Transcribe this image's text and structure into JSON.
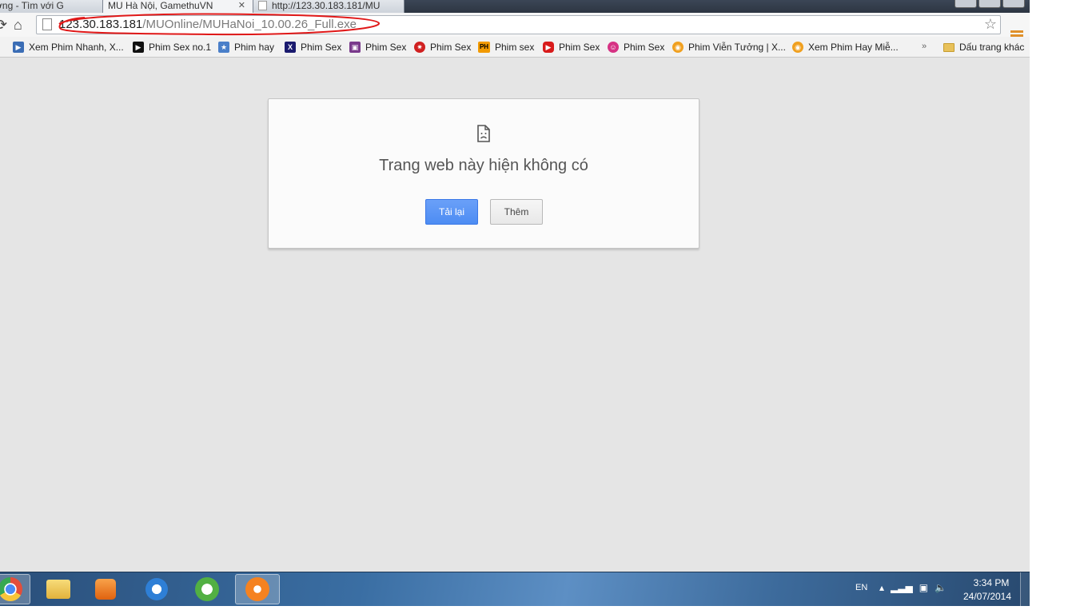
{
  "tabs": [
    {
      "title": "ương - Tìm với G",
      "close": "✕"
    },
    {
      "title": "MU Hà Nội, GamethuVN",
      "close": "✕"
    },
    {
      "title": "http://123.30.183.181/MU",
      "close": ""
    }
  ],
  "omnibox": {
    "url_host": "123.30.183.181",
    "url_path": "/MUOnline/MUHaNoi_10.00.26_Full.exe"
  },
  "bookmarks": [
    {
      "label": "Xem Phim Nhanh, X...",
      "icon_color": "#3b6db5",
      "icon": "play-icon"
    },
    {
      "label": "Phim Sex no.1",
      "icon_color": "#111111",
      "icon": "play-icon"
    },
    {
      "label": "Phim hay",
      "icon_color": "#4a7fc9",
      "icon": "film-icon"
    },
    {
      "label": "Phim Sex",
      "icon_color": "#1a1a6e",
      "icon": "x-icon",
      "glyph": "X"
    },
    {
      "label": "Phim Sex",
      "icon_color": "#7a3a8c",
      "icon": "tv-icon"
    },
    {
      "label": "Phim Sex",
      "icon_color": "#d02020",
      "icon": "splat-icon"
    },
    {
      "label": "Phim sex",
      "icon_color": "#f29a00",
      "icon": "ph-icon",
      "glyph": "PH"
    },
    {
      "label": "Phim Sex",
      "icon_color": "#d81b1b",
      "icon": "youtube-icon"
    },
    {
      "label": "Phim Sex",
      "icon_color": "#d63384",
      "icon": "smile-icon"
    },
    {
      "label": "Phim Viễn Tưởng | X...",
      "icon_color": "#f0a020",
      "icon": "circle-icon"
    },
    {
      "label": "Xem Phim Hay Miễ...",
      "icon_color": "#f0a020",
      "icon": "circle-icon"
    }
  ],
  "bookmarks_overflow": "»",
  "other_bookmarks": "Dấu trang khác",
  "error": {
    "title": "Trang web này hiện không có",
    "reload_label": "Tải lại",
    "more_label": "Thêm"
  },
  "taskbar": {
    "apps": [
      {
        "name": "chrome",
        "color": "#e44d3a"
      },
      {
        "name": "explorer",
        "color": "#f2c94c"
      },
      {
        "name": "media-player",
        "color": "#f07a1a"
      },
      {
        "name": "internet-explorer",
        "color": "#2e7fd6"
      },
      {
        "name": "coccoc",
        "color": "#52b043"
      },
      {
        "name": "avast",
        "color": "#f58220"
      }
    ],
    "lang": "EN",
    "time": "3:34 PM",
    "date": "24/07/2014"
  },
  "colors": {
    "accent_blue": "#4d8cf3",
    "annotation_red": "#e01818"
  }
}
